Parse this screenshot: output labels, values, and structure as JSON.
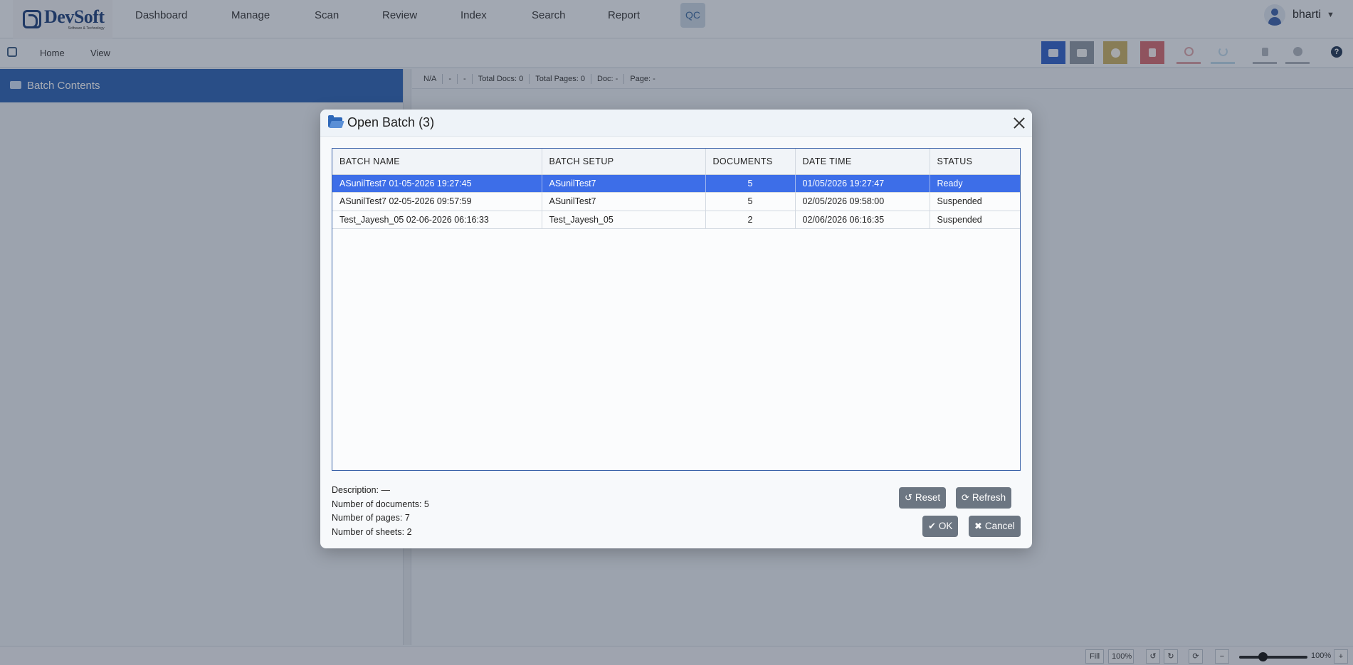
{
  "app": {
    "logo_text": "DevSoft",
    "logo_sub": "Software & Technology"
  },
  "nav": {
    "items": [
      "Dashboard",
      "Manage",
      "Scan",
      "Review",
      "Index",
      "Search",
      "Report"
    ],
    "active": "QC",
    "user": "bharti"
  },
  "subbar": {
    "items": [
      "Home",
      "View"
    ],
    "help": "?"
  },
  "toolbar": {
    "buttons": [
      {
        "name": "open-batch-icon",
        "color": "#2e5fc8"
      },
      {
        "name": "folder-icon",
        "color": "#8c96a2"
      },
      {
        "name": "pause-icon",
        "color": "#c9b062"
      },
      {
        "name": "delete-icon",
        "color": "#d46a6e"
      },
      {
        "name": "ban-icon",
        "color": "#d89ba0"
      },
      {
        "name": "undo-icon",
        "color": "#b9d6e8"
      },
      {
        "name": "document-icon",
        "color": "#a5acb6"
      },
      {
        "name": "info-icon",
        "color": "#a5acb6"
      }
    ]
  },
  "left_panel": {
    "title": "Batch Contents"
  },
  "info_bar": {
    "fields": [
      "N/A",
      "-",
      "-",
      "Total Docs: 0",
      "Total Pages: 0",
      "Doc: -",
      "Page: -"
    ]
  },
  "status_bar": {
    "fill_label": "Fill",
    "zoom_left": "100%",
    "zoom_right": "100%",
    "minus": "−",
    "plus": "+"
  },
  "modal": {
    "title": "Open Batch (3)",
    "columns": [
      "BATCH NAME",
      "BATCH SETUP",
      "DOCUMENTS",
      "DATE TIME",
      "STATUS"
    ],
    "rows": [
      {
        "name": "ASunilTest7 01-05-2026 19:27:45",
        "setup": "ASunilTest7",
        "documents": "5",
        "datetime": "01/05/2026 19:27:47",
        "status": "Ready",
        "selected": true
      },
      {
        "name": "ASunilTest7 02-05-2026 09:57:59",
        "setup": "ASunilTest7",
        "documents": "5",
        "datetime": "02/05/2026 09:58:00",
        "status": "Suspended",
        "selected": false
      },
      {
        "name": "Test_Jayesh_05 02-06-2026 06:16:33",
        "setup": "Test_Jayesh_05",
        "documents": "2",
        "datetime": "02/06/2026 06:16:35",
        "status": "Suspended",
        "selected": false
      }
    ],
    "details": {
      "description": "Description: —",
      "documents": "Number of documents: 5",
      "pages": "Number of pages: 7",
      "sheets": "Number of sheets: 2"
    },
    "buttons": {
      "reset": "Reset",
      "refresh": "Refresh",
      "ok": "OK",
      "cancel": "Cancel"
    }
  }
}
